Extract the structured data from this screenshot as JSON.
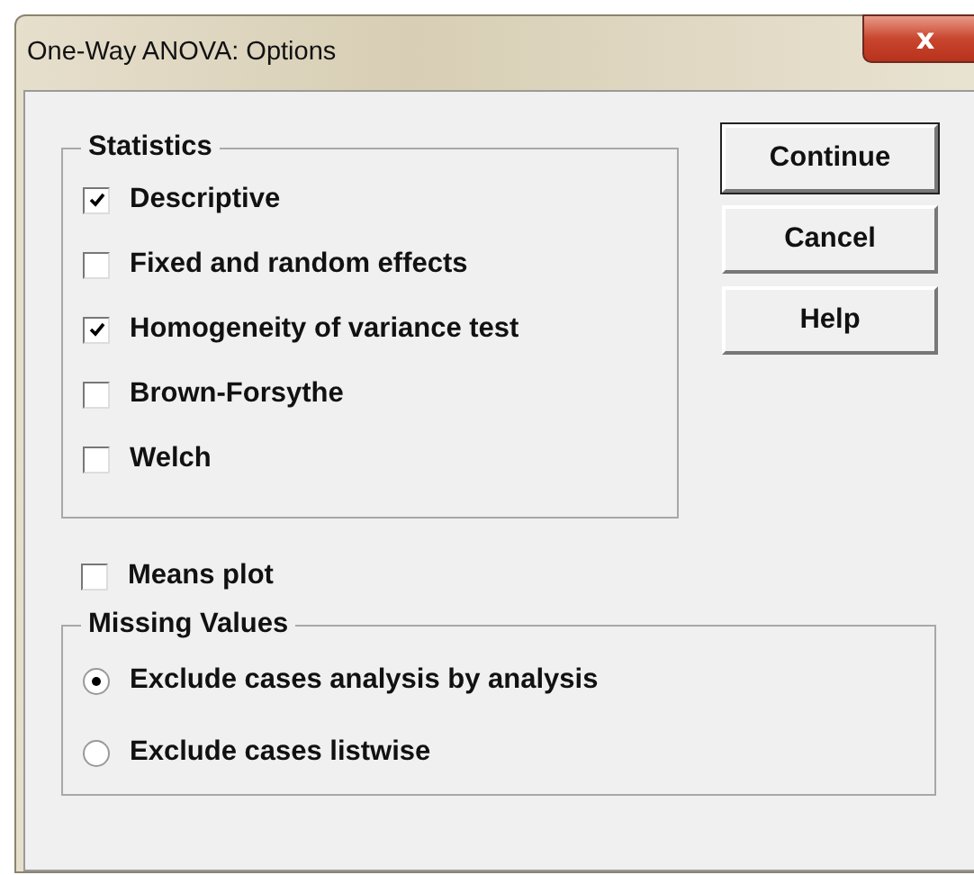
{
  "window": {
    "title": "One-Way ANOVA: Options",
    "close": "x"
  },
  "statistics": {
    "title": "Statistics",
    "items": [
      {
        "label": "Descriptive",
        "checked": true
      },
      {
        "label": "Fixed and random effects",
        "checked": false
      },
      {
        "label": "Homogeneity of variance test",
        "checked": true
      },
      {
        "label": "Brown-Forsythe",
        "checked": false
      },
      {
        "label": "Welch",
        "checked": false
      }
    ]
  },
  "buttons": [
    {
      "label": "Continue",
      "default": true
    },
    {
      "label": "Cancel",
      "default": false
    },
    {
      "label": "Help",
      "default": false
    }
  ],
  "means_plot": {
    "label": "Means plot",
    "checked": false
  },
  "missing_values": {
    "title": "Missing Values",
    "options": [
      {
        "label": "Exclude cases analysis by analysis",
        "selected": true
      },
      {
        "label": "Exclude cases listwise",
        "selected": false
      }
    ]
  }
}
